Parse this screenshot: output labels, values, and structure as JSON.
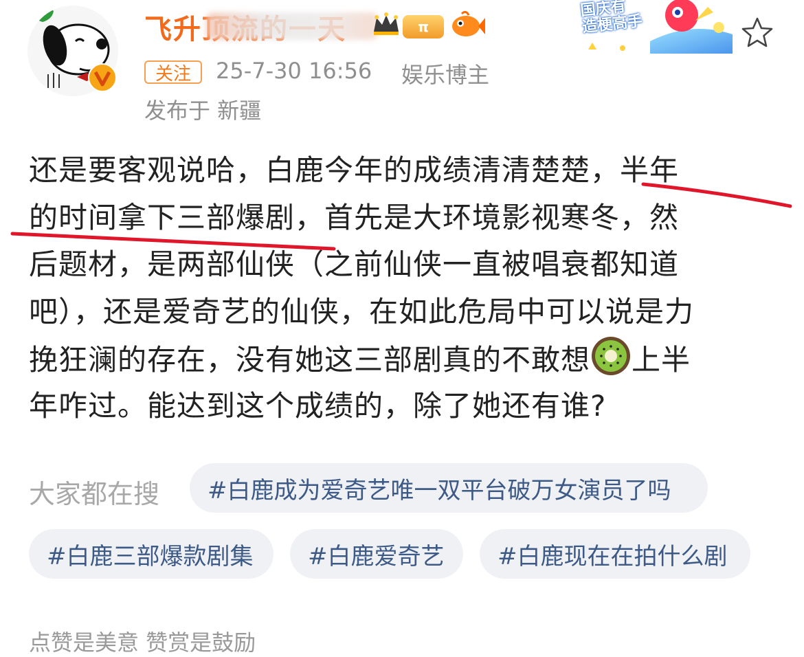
{
  "header": {
    "username": "飞升顶流的一天",
    "level_badge": "π",
    "follow_label": "关注",
    "post_time": "25-7-30 16:56",
    "post_role": "娱乐博主",
    "location": "发布于 新疆",
    "promo_banner_text": "国庆有\n造梗高手"
  },
  "post": {
    "lines": [
      "还是要客观说哈，白鹿今年的成绩清清楚楚，半年",
      "的时间拿下三部爆剧，首先是大环境影视寒冬，然",
      "后题材，是两部仙侠（之前仙侠一直被唱衰都知道",
      "吧），还是爱奇艺的仙侠，在如此危局中可以说是力",
      "挽狂澜的存在，没有她这三部剧真的不敢想",
      "上半",
      "年咋过。能达到这个成绩的，除了她还有谁?"
    ]
  },
  "search": {
    "label": "大家都在搜",
    "tags": [
      "#白鹿成为爱奇艺唯一双平台破万女演员了吗",
      "#白鹿三部爆款剧集",
      "#白鹿爱奇艺",
      "#白鹿现在在拍什么剧"
    ]
  },
  "footer": {
    "cutoff_text": "点赞是美意  赞赏是鼓励"
  },
  "icons": {
    "avatar": "snoopy-avatar",
    "verified": "verified-v-badge-icon",
    "crown": "crown-icon",
    "fish": "fish-icon",
    "star": "star-icon",
    "kiwi": "kiwi-emoji-icon"
  },
  "colors": {
    "username": "#f26b1d",
    "follow_border": "#f5a050",
    "meta_text": "#8f8f8f",
    "body_text": "#222222",
    "tag_bg": "#eff1f5",
    "tag_text": "#3d5a86",
    "underline": "#e0162b"
  }
}
